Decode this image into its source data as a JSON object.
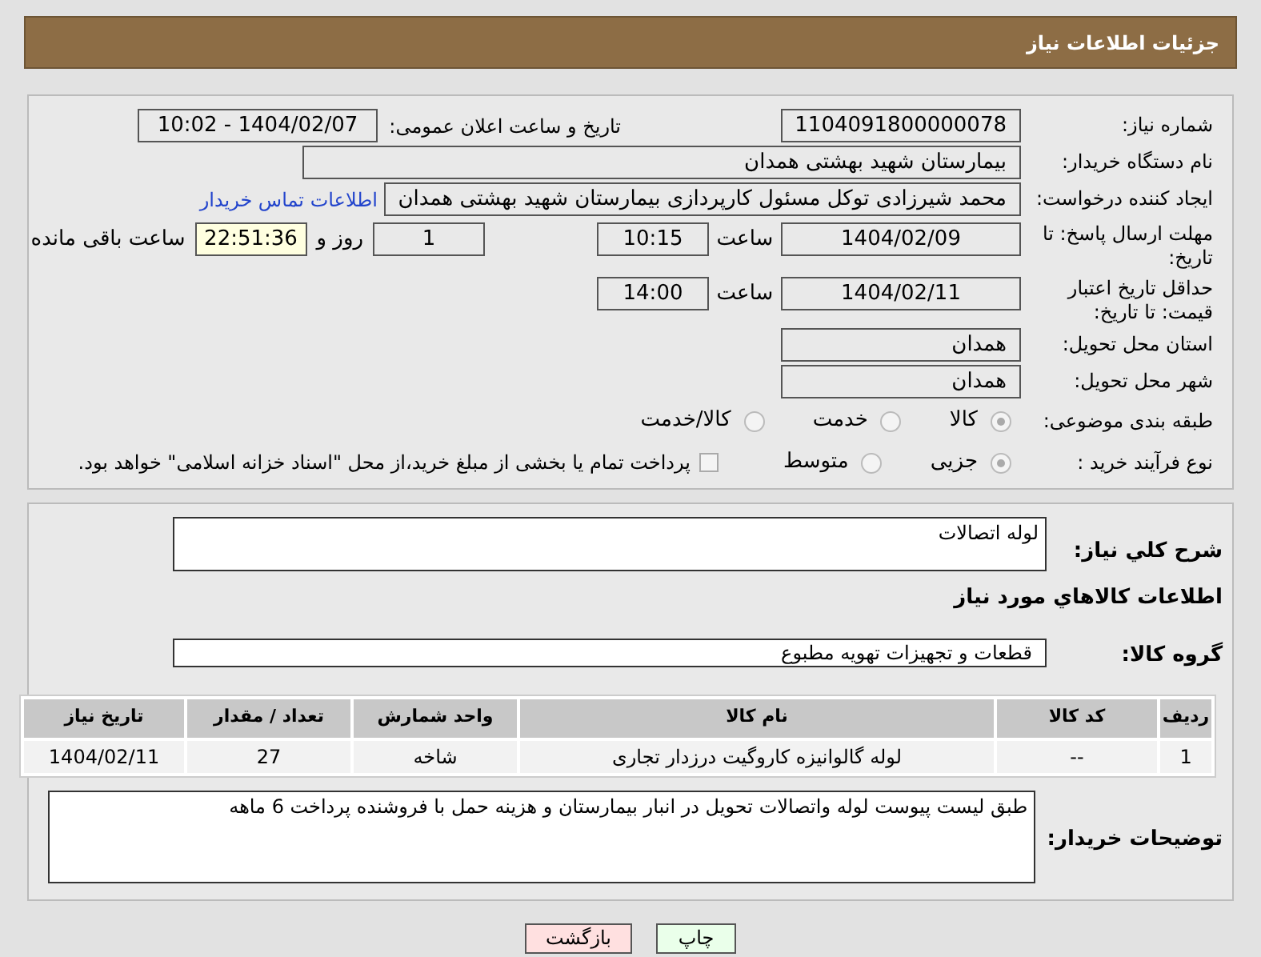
{
  "header": {
    "title": "جزئیات اطلاعات نیاز"
  },
  "need_number": {
    "label": "شماره نیاز:",
    "value": "1104091800000078"
  },
  "announce": {
    "label": "تاریخ و ساعت اعلان عمومی:",
    "value": "1404/02/07 - 10:02"
  },
  "buyer_org": {
    "label": "نام دستگاه خریدار:",
    "value": "بیمارستان شهید بهشتی همدان"
  },
  "requester": {
    "label": "ایجاد کننده درخواست:",
    "value": "محمد شیرزادی توکل مسئول کارپردازی بیمارستان شهید بهشتی همدان",
    "link": "اطلاعات تماس خریدار"
  },
  "deadline": {
    "label": "مهلت ارسال پاسخ: تا تاریخ:",
    "date": "1404/02/09",
    "time_label": "ساعت",
    "time": "10:15",
    "days": "1",
    "days_label": "روز و",
    "remaining": "22:51:36",
    "remaining_label": "ساعت باقی مانده"
  },
  "validity": {
    "label": "حداقل تاریخ اعتبار قیمت: تا تاریخ:",
    "date": "1404/02/11",
    "time_label": "ساعت",
    "time": "14:00"
  },
  "province": {
    "label": "استان محل تحویل:",
    "value": "همدان"
  },
  "city": {
    "label": "شهر محل تحویل:",
    "value": "همدان"
  },
  "category": {
    "label": "طبقه بندی موضوعی:",
    "options": [
      {
        "label": "کالا",
        "selected": true
      },
      {
        "label": "خدمت",
        "selected": false
      },
      {
        "label": "کالا/خدمت",
        "selected": false
      }
    ]
  },
  "purchase_type": {
    "label": "نوع فرآیند خرید :",
    "options": [
      {
        "label": "جزیی",
        "selected": true
      },
      {
        "label": "متوسط",
        "selected": false
      }
    ],
    "payment_note": {
      "label": "پرداخت تمام یا بخشی از مبلغ خرید،از محل \"اسناد خزانه اسلامی\" خواهد بود.",
      "checked": false
    }
  },
  "description": {
    "label": "شرح کلي نياز:",
    "value": "لوله اتصالات"
  },
  "goods_title": "اطلاعات کالاهاي مورد نياز",
  "goods_group": {
    "label": "گروه کالا:",
    "value": "قطعات و تجهیزات تهویه مطبوع"
  },
  "table": {
    "columns": [
      "ردیف",
      "کد کالا",
      "نام کالا",
      "واحد شمارش",
      "تعداد / مقدار",
      "تاریخ نیاز"
    ],
    "rows": [
      [
        "1",
        "--",
        "لوله گالوانیزه کاروگیت درزدار تجاری",
        "شاخه",
        "27",
        "1404/02/11"
      ]
    ]
  },
  "buyer_notes": {
    "label": "توضیحات خریدار:",
    "value": "طبق لیست پیوست لوله واتصالات تحویل در انبار بیمارستان و هزینه حمل با فروشنده پرداخت 6 ماهه"
  },
  "buttons": [
    {
      "label": "چاپ",
      "kind": "print"
    },
    {
      "label": "بازگشت",
      "kind": "back"
    }
  ]
}
